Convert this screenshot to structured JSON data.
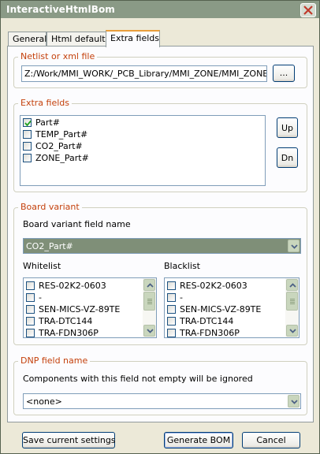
{
  "window": {
    "title": "InteractiveHtmlBom",
    "close_label": "✕"
  },
  "tabs": [
    {
      "label": "General",
      "active": false
    },
    {
      "label": "Html defaults",
      "active": false
    },
    {
      "label": "Extra fields",
      "active": true
    }
  ],
  "netlist": {
    "legend": "Netlist or xml file",
    "path": "Z:/Work/MMI_WORK/_PCB_Library/MMI_ZONE/MMI_ZONE.net",
    "browse_label": "..."
  },
  "extra_fields": {
    "legend": "Extra fields",
    "items": [
      {
        "label": "Part#",
        "checked": true
      },
      {
        "label": "TEMP_Part#",
        "checked": false
      },
      {
        "label": "CO2_Part#",
        "checked": false
      },
      {
        "label": "ZONE_Part#",
        "checked": false
      }
    ],
    "up_label": "Up",
    "down_label": "Dn"
  },
  "board_variant": {
    "legend": "Board variant",
    "field_name_label": "Board variant field name",
    "field_name_value": "CO2_Part#",
    "whitelist_label": "Whitelist",
    "blacklist_label": "Blacklist",
    "whitelist": [
      "RES-02K2-0603",
      "-",
      "SEN-MICS-VZ-89TE",
      "TRA-DTC144",
      "TRA-FDN306P"
    ],
    "blacklist": [
      "RES-02K2-0603",
      "-",
      "SEN-MICS-VZ-89TE",
      "TRA-DTC144",
      "TRA-FDN306P"
    ]
  },
  "dnp": {
    "legend": "DNP field name",
    "description": "Components with this field not empty will be ignored",
    "value": "<none>"
  },
  "footer": {
    "save_label": "Save current settings",
    "generate_label": "Generate BOM",
    "cancel_label": "Cancel"
  },
  "colors": {
    "legend_text": "#c4410c",
    "active_tab_accent": "#e99e3b",
    "titlebar": "#8a9a86"
  }
}
